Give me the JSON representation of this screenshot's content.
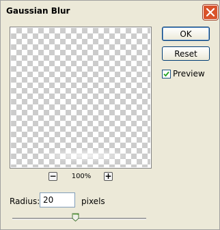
{
  "window": {
    "title": "Gaussian Blur"
  },
  "preview": {
    "zoom_level": "100%",
    "zoom_out_symbol": "−",
    "zoom_in_symbol": "+"
  },
  "buttons": {
    "ok_label": "OK",
    "reset_label": "Reset"
  },
  "preview_toggle": {
    "label": "Preview",
    "checked": true
  },
  "radius": {
    "label": "Radius:",
    "value": "20",
    "units": "pixels",
    "slider_fraction": 0.47
  },
  "icons": {
    "close": "close-icon",
    "checkmark": "checkmark-icon",
    "slider_thumb": "slider-thumb-icon"
  },
  "colors": {
    "dialog_background": "#ece9d8",
    "close_button": "#d9532b",
    "checker_dark": "#cccccc"
  }
}
